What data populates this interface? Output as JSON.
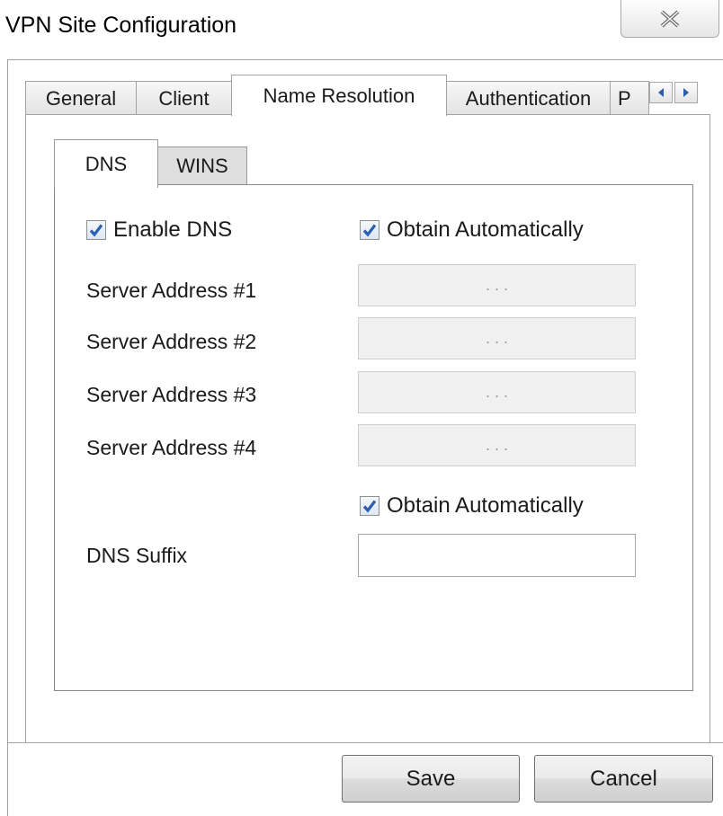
{
  "window": {
    "title": "VPN Site Configuration",
    "close_icon": "close-icon"
  },
  "main_tabs": [
    {
      "label": "General",
      "active": false
    },
    {
      "label": "Client",
      "active": false
    },
    {
      "label": "Name Resolution",
      "active": true
    },
    {
      "label": "Authentication",
      "active": false
    },
    {
      "label": "P",
      "active": false
    }
  ],
  "tab_scroll": {
    "left_icon": "triangle-left-icon",
    "right_icon": "triangle-right-icon"
  },
  "inner_tabs": [
    {
      "label": "DNS",
      "active": true
    },
    {
      "label": "WINS",
      "active": false
    }
  ],
  "dns": {
    "enable_dns": {
      "label": "Enable DNS",
      "checked": true
    },
    "obtain_servers_auto": {
      "label": "Obtain Automatically",
      "checked": true
    },
    "servers": [
      {
        "label": "Server Address #1",
        "value": ". . ."
      },
      {
        "label": "Server Address #2",
        "value": ". . ."
      },
      {
        "label": "Server Address #3",
        "value": ". . ."
      },
      {
        "label": "Server Address #4",
        "value": ". . ."
      }
    ],
    "obtain_suffix_auto": {
      "label": "Obtain Automatically",
      "checked": true
    },
    "suffix": {
      "label": "DNS Suffix",
      "value": ""
    }
  },
  "buttons": {
    "save": "Save",
    "cancel": "Cancel"
  },
  "colors": {
    "checkmark": "#2b5fb3"
  }
}
